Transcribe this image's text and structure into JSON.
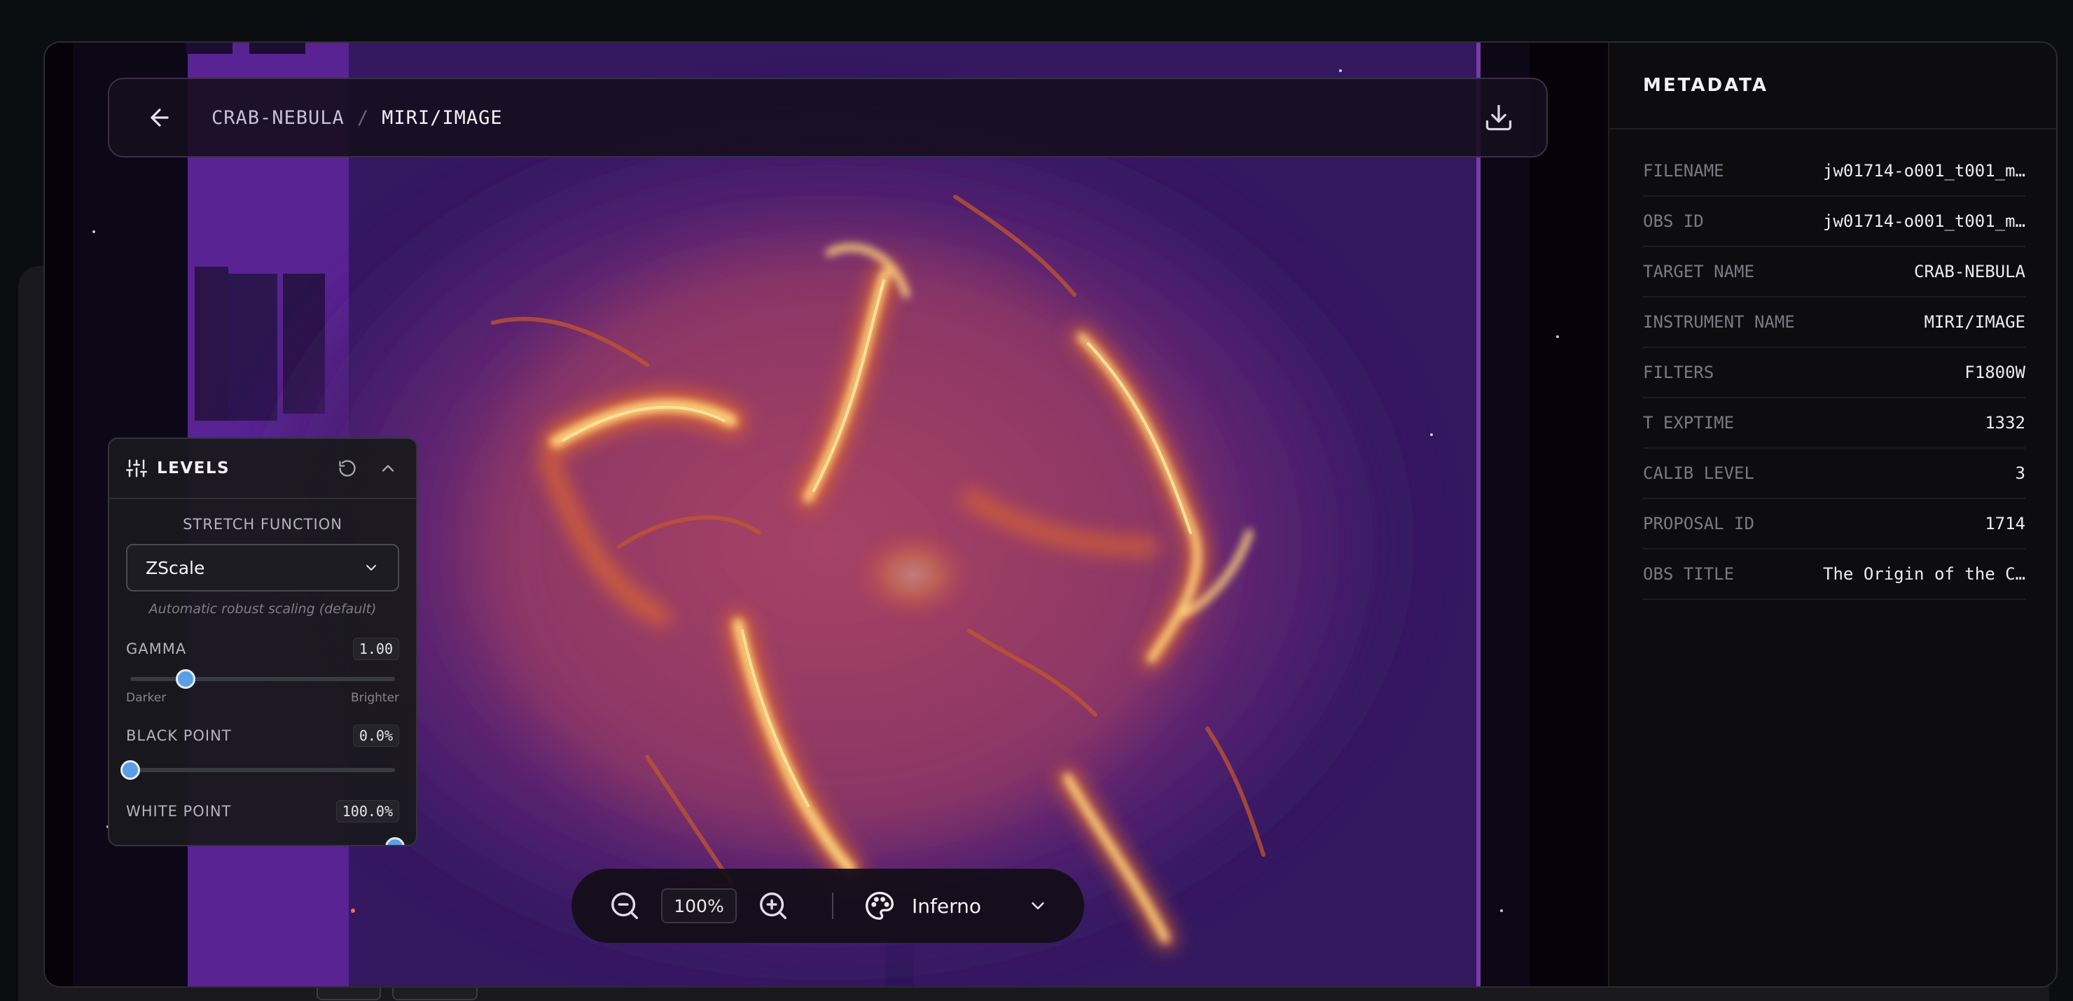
{
  "header": {
    "crumbs": [
      "CRAB-NEBULA",
      "MIRI/IMAGE"
    ],
    "separator": "/",
    "back_icon": "arrow-left-icon",
    "download_icon": "download-icon"
  },
  "levels": {
    "title": "LEVELS",
    "stretch_label": "STRETCH FUNCTION",
    "stretch_value": "ZScale",
    "stretch_hint": "Automatic robust scaling (default)",
    "gamma": {
      "label": "GAMMA",
      "value": "1.00",
      "left_label": "Darker",
      "right_label": "Brighter",
      "position": 0.21
    },
    "black_point": {
      "label": "BLACK POINT",
      "value": "0.0%",
      "position": 0.0
    },
    "white_point": {
      "label": "WHITE POINT",
      "value": "100.0%",
      "position": 1.0
    }
  },
  "toolbar": {
    "zoom": "100%",
    "colormap": "Inferno"
  },
  "metadata": {
    "title": "METADATA",
    "rows": [
      {
        "key": "FILENAME",
        "value": "jw01714-o001_t001_m…"
      },
      {
        "key": "OBS ID",
        "value": "jw01714-o001_t001_m…"
      },
      {
        "key": "TARGET NAME",
        "value": "CRAB-NEBULA"
      },
      {
        "key": "INSTRUMENT NAME",
        "value": "MIRI/IMAGE"
      },
      {
        "key": "FILTERS",
        "value": "F1800W"
      },
      {
        "key": "T EXPTIME",
        "value": "1332"
      },
      {
        "key": "CALIB LEVEL",
        "value": "3"
      },
      {
        "key": "PROPOSAL ID",
        "value": "1714"
      },
      {
        "key": "OBS TITLE",
        "value": "The Origin of the C…"
      }
    ]
  },
  "colors": {
    "accent": "#5a9ee8",
    "nebula_core": "#ffd27a",
    "nebula_mid": "#e8702a",
    "nebula_glow": "#8a2f8a",
    "field": "#3a1a66"
  }
}
